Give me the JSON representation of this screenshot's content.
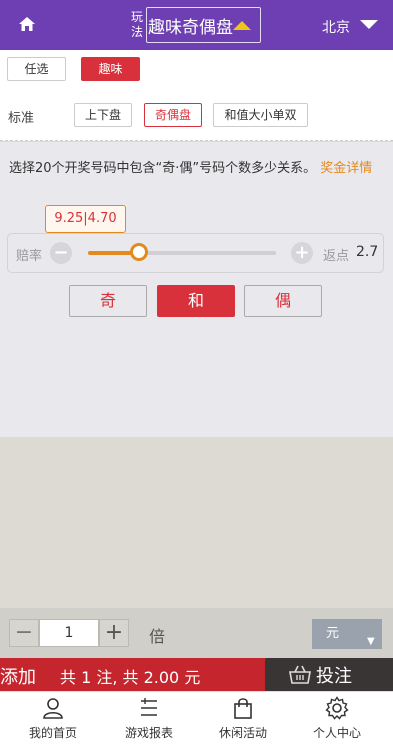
{
  "header": {
    "play_label": "玩法",
    "game_name": "趣味奇偶盘",
    "city": "北京"
  },
  "modes": [
    "任选",
    "趣味"
  ],
  "sub_tabs": {
    "group_label": "标准",
    "items": [
      "上下盘",
      "奇偶盘",
      "和值大小单双"
    ],
    "selected": "奇偶盘"
  },
  "description": {
    "text": "选择20个开奖号码中包含“奇·偶”号码个数多少关系。",
    "link": "奖金详情"
  },
  "odds": {
    "tip": "9.25|4.70",
    "label": "赔率",
    "rebate_label": "返点",
    "rebate_value": "2.7",
    "slider_fraction": 0.27
  },
  "picks": [
    "奇",
    "和",
    "偶"
  ],
  "selected_pick": "和",
  "multiplier": {
    "value": "1",
    "unit": "倍",
    "currency": "元"
  },
  "actions": {
    "add": "添加",
    "summary": "共 1 注, 共 2.00 元",
    "submit": "投注"
  },
  "tabs": [
    "我的首页",
    "游戏报表",
    "休闲活动",
    "个人中心"
  ],
  "colors": {
    "header": "#6e3fb3",
    "accent_red": "#d9313b",
    "accent_orange": "#e38a1e",
    "arrow_yellow": "#f0c419"
  }
}
